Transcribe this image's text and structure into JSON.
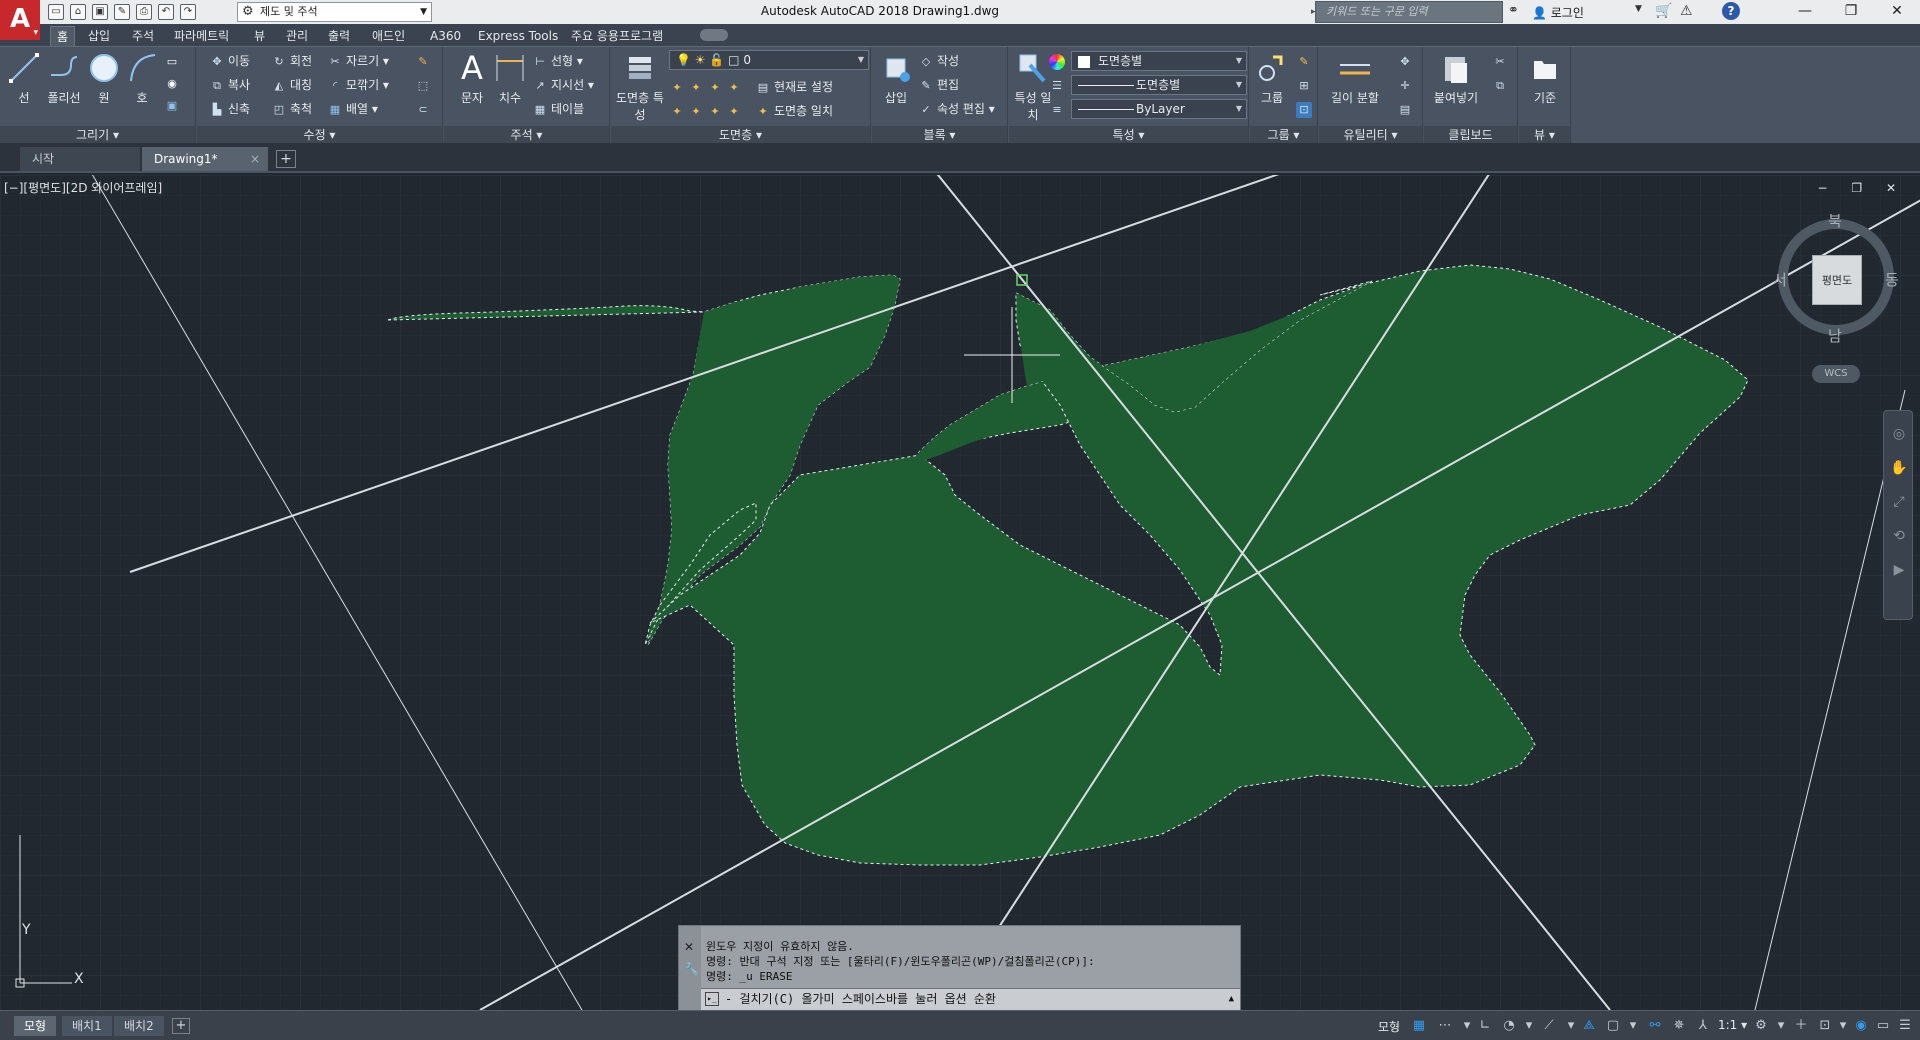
{
  "titlebar": {
    "app_logo": "A",
    "workspace": "제도 및 주석",
    "window_title": "Autodesk AutoCAD 2018    Drawing1.dwg",
    "search_placeholder": "키워드 또는 구문 입력",
    "login": "로그인",
    "help": "?",
    "minimize": "—",
    "restore": "❐",
    "close": "✕"
  },
  "ribbon_tabs": [
    "홈",
    "삽입",
    "주석",
    "파라메트릭",
    "뷰",
    "관리",
    "출력",
    "애드인",
    "A360",
    "Express Tools",
    "주요 응용프로그램"
  ],
  "ribbon": {
    "draw": {
      "title": "그리기 ▾",
      "tools": [
        "선",
        "폴리선",
        "원",
        "호"
      ]
    },
    "modify": {
      "title": "수정 ▾",
      "row1": [
        "이동",
        "회전",
        "자르기 ▾"
      ],
      "row2": [
        "복사",
        "대칭",
        "모깎기 ▾"
      ],
      "row3": [
        "신축",
        "축척",
        "배열 ▾"
      ]
    },
    "annotation": {
      "title": "주석 ▾",
      "big": [
        "문자",
        "치수"
      ],
      "small": [
        "선형 ▾",
        "지시선 ▾",
        "테이블"
      ]
    },
    "layers": {
      "title": "도면층 ▾",
      "big": "도면층 특성",
      "current_layer": "0",
      "small": [
        "현재로 설정",
        "도면층 일치"
      ]
    },
    "block": {
      "title": "블록 ▾",
      "big": "삽입",
      "small": [
        "작성",
        "편집",
        "속성 편집 ▾"
      ]
    },
    "properties": {
      "title": "특성 ▾",
      "big": "특성 일치",
      "color": "도면층별",
      "linetype": "도면층별",
      "lineweight": "ByLayer"
    },
    "groups": {
      "title": "그룹 ▾",
      "big": "그룹"
    },
    "utilities": {
      "title": "유틸리티 ▾",
      "big": "길이 분할"
    },
    "clipboard": {
      "title": "클립보드",
      "big": "붙여넣기"
    },
    "view": {
      "title": "뷰 ▾",
      "big": "기준"
    }
  },
  "doc_tabs": {
    "start": "시작",
    "drawing": "Drawing1*",
    "close": "×",
    "new": "+"
  },
  "viewport": {
    "label": "[−][평면도][2D 와이어프레임]",
    "controls": "− ❐ ✕"
  },
  "viewcube": {
    "face": "평면도",
    "north": "북",
    "south": "남",
    "east": "동",
    "west": "서",
    "wcs": "WCS"
  },
  "ucs": {
    "x": "X",
    "y": "Y"
  },
  "command": {
    "line1": "윈도우 지정이 유효하지 않음.",
    "line2": "명령: 반대 구석 지정 또는 [울타리(F)/윈도우폴리곤(WP)/걸침폴리곤(CP)]:",
    "line3": "명령: _u ERASE",
    "input": "- 걸치기(C) 올가미  스페이스바를 눌러 옵션 순환"
  },
  "statusbar": {
    "layouts": [
      "모형",
      "배치1",
      "배치2"
    ],
    "add": "+",
    "model": "모형",
    "scale": "1:1 ▾"
  },
  "colors": {
    "canvas": "#212830",
    "hatch": "#1e5c32",
    "accent": "#2f9cf0",
    "logo": "#c6282b"
  }
}
